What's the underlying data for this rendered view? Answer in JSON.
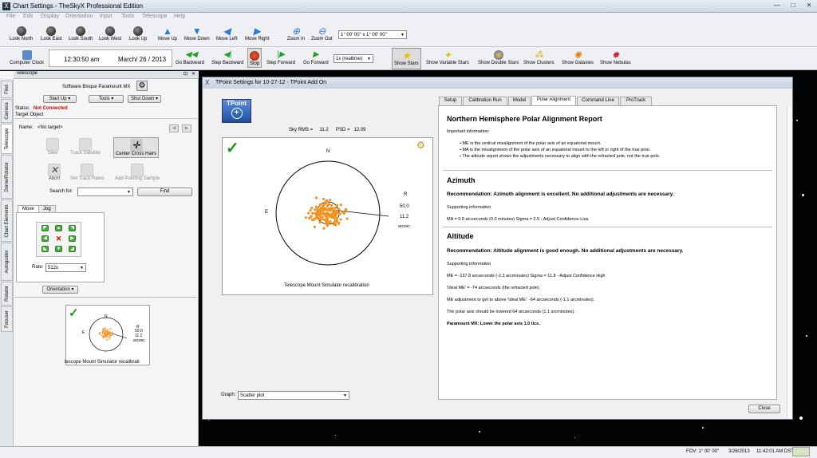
{
  "window": {
    "title": "Chart Settings - TheSkyX Professional Edition",
    "min": "—",
    "max": "□",
    "close": "✕"
  },
  "menu": [
    "File",
    "Edit",
    "Display",
    "Orientation",
    "Input",
    "Tools",
    "Telescope",
    "Help"
  ],
  "toolbar1": {
    "items": [
      "Look North",
      "Look East",
      "Look South",
      "Look West",
      "Look Up",
      "Move Up",
      "Move Down",
      "Move Left",
      "Move Right",
      "Zoom In",
      "Zoom Out"
    ],
    "fov_select": "1° 00' 00\" x 1° 00' 00\""
  },
  "toolbar2": {
    "computer_clock": "Computer Clock",
    "time": "12:30:50 am",
    "date": "March/ 26 / 2013",
    "controls": [
      "Go Backward",
      "Step Backward",
      "Stop",
      "Step Forward",
      "Go Forward"
    ],
    "rate_select": "1x (realtime)",
    "show": [
      "Show Stars",
      "Show Variable Stars",
      "Show Double Stars",
      "Show Clusters",
      "Show Galaxies",
      "Show Nebulas"
    ]
  },
  "panel": {
    "title": "Telescope",
    "vtabs": [
      "Find",
      "Camera",
      "Telescope",
      "Dome/Rotator",
      "Chart Elements",
      "Autoguider",
      "Rotator",
      "Focuser"
    ],
    "mount_name": "Software Bisque Paramount MX",
    "start_up": "Start Up",
    "tools": "Tools",
    "shut_down": "Shut Down",
    "status_label": "Status:",
    "status_value": "Not Connected",
    "target_object": "Target Object",
    "name_label": "Name:",
    "name_value": "<No target>",
    "slew": "Slew",
    "track_satellite": "Track Satellite",
    "center_cross_hairs": "Center Cross Hairs",
    "abort": "Abort",
    "set_track_rates": "Set Track Rates",
    "add_pointing_sample": "Add Pointing Sample",
    "search_label": "Search for:",
    "find": "Find",
    "tab_move": "Move",
    "tab_jog": "Jog",
    "rate_label": "Rate:",
    "rate_value": "512x",
    "orientation": "Orientation",
    "thumb_caption": "lescope Mount Simulator recalibrati",
    "thumb_r": "R",
    "thumb_50": "50.0",
    "thumb_112": "11.2",
    "thumb_as": "arcsec",
    "thumb_n": "N",
    "thumb_e": "E"
  },
  "dialog": {
    "title": "TPoint Settings for 10-27-12 - TPoint Add On",
    "logo": "TPoint",
    "sky_rms": "Sky RMS =     11.2",
    "psd": "PSD =   12.09",
    "plot_n": "N",
    "plot_e": "E",
    "plot_r": "R",
    "plot_50": "50.0",
    "plot_112": "11.2",
    "plot_as": "arcsec",
    "plot_caption": "Telescope Mount Simulator recalibration",
    "graph_label": "Graph:",
    "graph_value": "Scatter plot",
    "tabs": [
      "Setup",
      "Calibration Run",
      "Model",
      "Polar Alignment",
      "Command Line",
      "ProTrack"
    ],
    "close": "Close"
  },
  "report": {
    "heading": "Northern Hemisphere Polar Alignment Report",
    "important": "Important information:",
    "b1": "• ME is the vertical misalignment of the polar axis of an equatorial mount.",
    "b2": "• MA is the misalignment of the polar axis of an equatorial mount to the left or right of the true pole.",
    "b3": "• The altitude report shows the adjustments necessary to align with the refracted pole, not the true pole.",
    "az_head": "Azimuth",
    "az_rec": "Recommendation: Azimuth alignment is excellent. No additional adjustments are necessary.",
    "az_sup": "Supporting information",
    "az_ma": "MA = 0.9 arcseconds (0.0 minutes) Sigma = 2.5 - Adjust Confidence-Low.",
    "alt_head": "Altitude",
    "alt_rec": "Recommendation: Altitude alignment is good enough. No additional adjustments are necessary.",
    "alt_sup": "Supporting information",
    "alt_me": "ME = -137.8 arcseconds (-2.3 arcminutes) Sigma = 11.8 - Adjust Confidence High",
    "alt_ideal": "'Ideal ME' = -74 arcseconds (the refracted pole).",
    "alt_adj": "ME adjustment to get to above 'Ideal ME': -64 arcseconds (-1.1 arcminutes).",
    "alt_lower": "The polar axis should be lowered 64 arcseconds (1.1 arcminutes).",
    "alt_pmx": "Paramount MX: Lower the polar axis 1.0 tics."
  },
  "status": {
    "fov": "FOV: 1° 00' 00\"",
    "date": "3/26/2013",
    "time": "11:42:01 AM DST"
  },
  "colors": {
    "accent": "#1e6fd0",
    "status_red": "#d40000",
    "scatter": "#f39420",
    "check": "#1a9a1a"
  }
}
